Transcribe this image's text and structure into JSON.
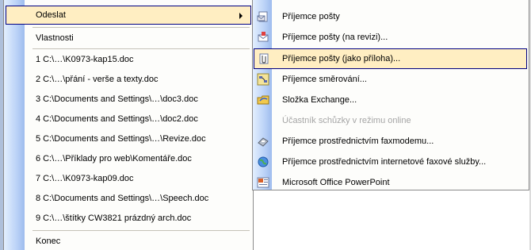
{
  "file_menu": {
    "items": [
      {
        "label": "Odeslat",
        "highlighted": true,
        "submenu": true
      },
      {
        "label": "Vlastnosti"
      },
      {
        "label": "1 C:\\…\\K0973-kap15.doc"
      },
      {
        "label": "2 C:\\…\\přání - verše a texty.doc"
      },
      {
        "label": "3 C:\\Documents and Settings\\…\\doc3.doc"
      },
      {
        "label": "4 C:\\Documents and Settings\\…\\doc2.doc"
      },
      {
        "label": "5 C:\\Documents and Settings\\…\\Revize.doc"
      },
      {
        "label": "6 C:\\…\\Příklady pro web\\Komentáře.doc"
      },
      {
        "label": "7 C:\\…\\K0973-kap09.doc"
      },
      {
        "label": "8 C:\\Documents and Settings\\…\\Speech.doc"
      },
      {
        "label": "9 C:\\…\\štítky CW3821 prázdný arch.doc"
      },
      {
        "label": "Konec"
      }
    ]
  },
  "send_submenu": {
    "items": [
      {
        "label": "Příjemce pošty",
        "icon": "mail-recipient-icon"
      },
      {
        "label": "Příjemce pošty (na revizi)...",
        "icon": "mail-review-icon"
      },
      {
        "label": "Příjemce pošty (jako příloha)...",
        "icon": "mail-attachment-icon",
        "highlighted": true
      },
      {
        "label": "Příjemce směrování...",
        "icon": "routing-recipient-icon"
      },
      {
        "label": "Složka Exchange...",
        "icon": "exchange-folder-icon"
      },
      {
        "label": "Účastník schůzky v režimu online",
        "icon": "",
        "disabled": true
      },
      {
        "label": "Příjemce prostřednictvím faxmodemu...",
        "icon": "fax-modem-icon"
      },
      {
        "label": "Příjemce prostřednictvím internetové faxové služby...",
        "icon": "internet-fax-icon"
      },
      {
        "label": "Microsoft Office PowerPoint",
        "icon": "powerpoint-icon"
      }
    ]
  },
  "colors": {
    "highlight_bg": "#ffeec2",
    "highlight_border": "#000080",
    "gutter": "#bcd3f7",
    "disabled_text": "#a5a5a5"
  }
}
